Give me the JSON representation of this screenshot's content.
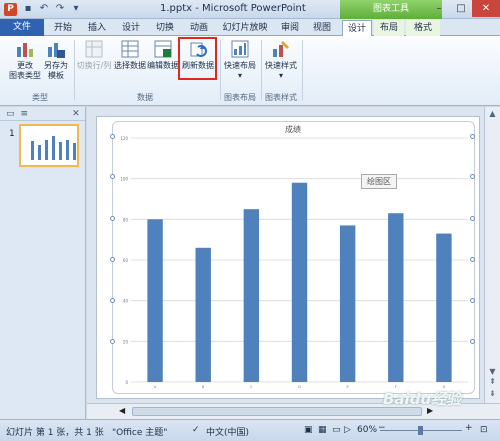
{
  "window": {
    "title": "1.pptx  -  Microsoft PowerPoint",
    "context_tools": "图表工具",
    "app_icon": "P"
  },
  "tabs": [
    "文件",
    "开始",
    "插入",
    "设计",
    "切换",
    "动画",
    "幻灯片放映",
    "审阅",
    "视图",
    "设计",
    "布局",
    "格式"
  ],
  "ribbon": {
    "buttons": {
      "change_type": "更改\n图表类型",
      "save_template": "另存为\n模板",
      "switch_row_col": "切换行/列",
      "select_data": "选择数据",
      "edit_data": "编辑数据",
      "refresh_data": "刷新数据",
      "quick_layout": "快速布局",
      "quick_style": "快速样式"
    },
    "groups": {
      "type": "类型",
      "data": "数据",
      "layout": "图表布局",
      "style": "图表样式"
    }
  },
  "slides_panel": {
    "slide_number": "1"
  },
  "tooltip": "绘图区",
  "chart_data": {
    "type": "bar",
    "title": "成绩",
    "categories": [
      "A",
      "B",
      "C",
      "D",
      "E",
      "F",
      "G"
    ],
    "values": [
      80,
      66,
      85,
      98,
      77,
      83,
      73
    ],
    "ylim": [
      0,
      120
    ],
    "yticks": [
      0,
      20,
      40,
      60,
      80,
      100,
      120
    ],
    "bar_color": "#4f81bd",
    "grid": true
  },
  "status": {
    "slide_info": "幻灯片 第 1 张，共 1 张",
    "theme": "\"Office 主题\"",
    "language": "中文(中国)",
    "zoom": "60%"
  },
  "watermark": "Baidu经验"
}
